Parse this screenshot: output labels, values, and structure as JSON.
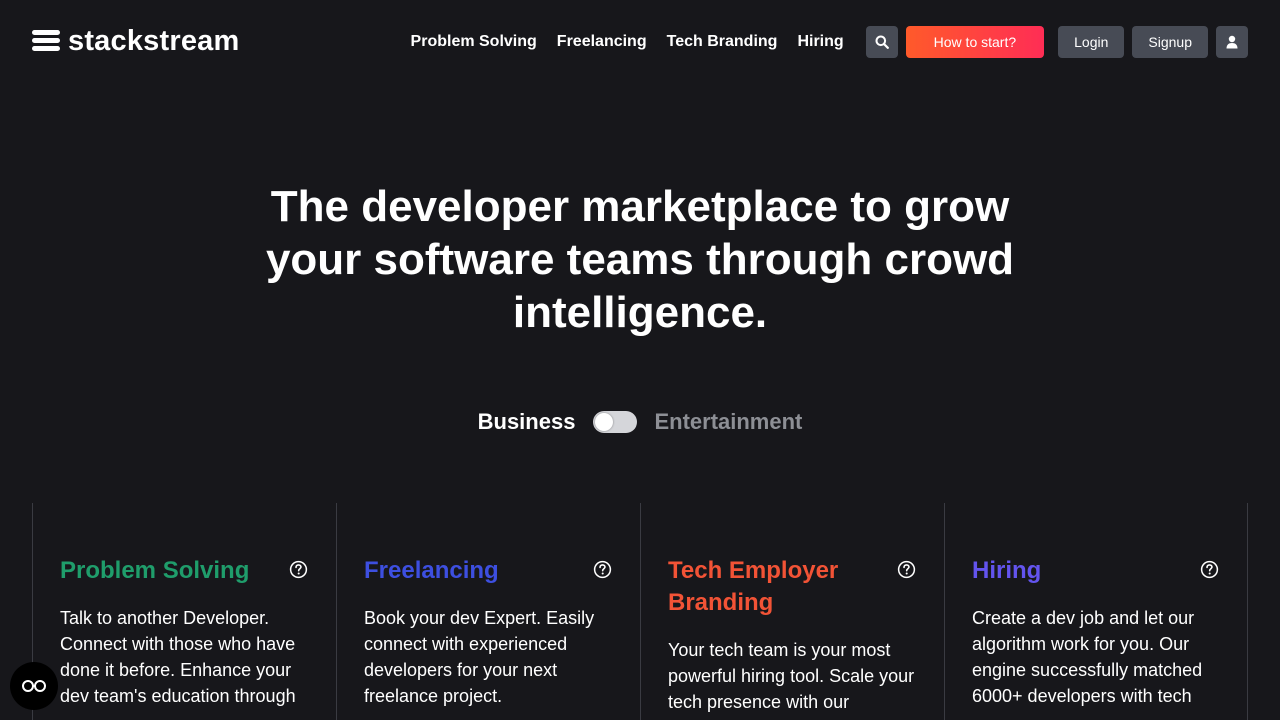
{
  "brand": {
    "name": "stackstream"
  },
  "nav": {
    "links": [
      "Problem Solving",
      "Freelancing",
      "Tech Branding",
      "Hiring"
    ],
    "search_icon": "search-icon",
    "cta_label": "How to start?",
    "login_label": "Login",
    "signup_label": "Signup",
    "user_icon": "user-icon"
  },
  "hero": {
    "title": "The developer marketplace to grow your software teams through crowd intelligence."
  },
  "toggle": {
    "left_label": "Business",
    "right_label": "Entertainment",
    "state": "Business"
  },
  "cards": [
    {
      "title": "Problem Solving",
      "color": "#1f9d6b",
      "text": "Talk to another Developer. Connect with those who have done it before. Enhance your dev team's education through"
    },
    {
      "title": "Freelancing",
      "color": "#3d4fe0",
      "text": "Book your dev Expert. Easily connect with experienced developers for your next freelance project."
    },
    {
      "title": "Tech Employer Branding",
      "color": "#f25336",
      "text": "Your tech team is your most powerful hiring tool. Scale your tech presence with our"
    },
    {
      "title": "Hiring",
      "color": "#6354ee",
      "text": "Create a dev job and let our algorithm work for you. Our engine successfully matched 6000+ developers with tech"
    }
  ],
  "colors": {
    "background": "#17171b",
    "cta_start": "#ff5a2a",
    "cta_end": "#ff2d55",
    "button_gray": "#474b55"
  },
  "floating": {
    "icon": "eye-glasses-icon"
  }
}
